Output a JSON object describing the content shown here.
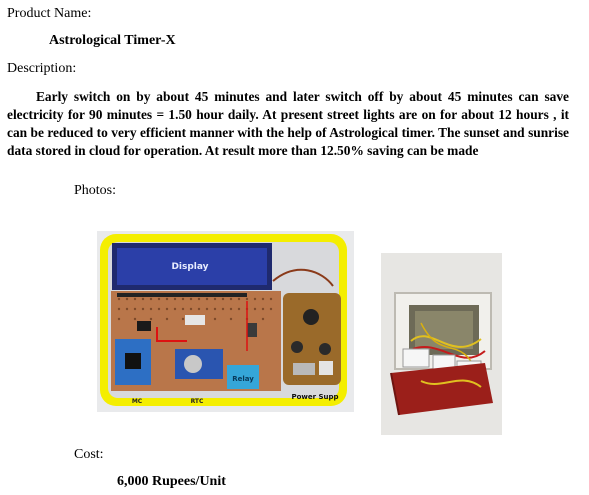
{
  "product": {
    "name_label": "Product Name:",
    "name_value": "Astrological Timer-X"
  },
  "description": {
    "label": "Description:",
    "body": "Early switch on by about 45 minutes and later switch off by about 45 minutes can save electricity for 90 minutes = 1.50 hour daily. At present street lights are on for about 12 hours , it can be reduced to very efficient manner with the help of Astrological timer. The sunset and sunrise data stored in cloud for operation. At result more than 12.50% saving can be made"
  },
  "photos": {
    "label": "Photos:",
    "circuit_labels": {
      "display": "Display",
      "relay": "Relay",
      "mc": "MC",
      "rtc": "RTC",
      "power_supply": "Power Supp"
    }
  },
  "cost": {
    "label": "Cost:",
    "value": "6,000 Rupees/Unit"
  },
  "colors": {
    "frame_yellow": "#f4ee00",
    "lcd_blue": "#2b3fa8",
    "pcb_brown": "#b9764a",
    "arduino_blue": "#2d6fc4",
    "relay_cyan": "#35a6d8",
    "box_red": "#9b1f1a"
  }
}
